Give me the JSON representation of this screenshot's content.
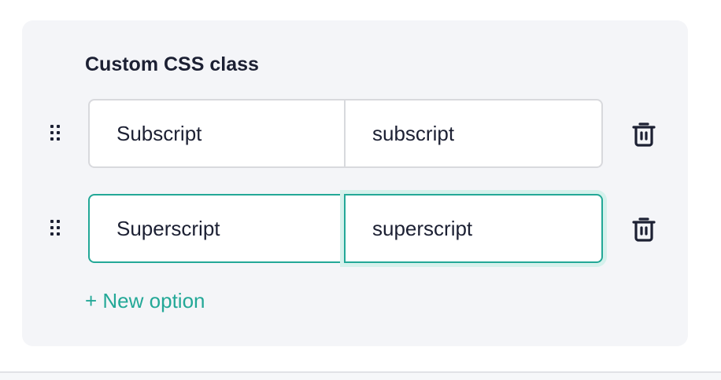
{
  "section": {
    "title": "Custom CSS class"
  },
  "options": [
    {
      "label": "Subscript",
      "value": "subscript",
      "state": "default"
    },
    {
      "label": "Superscript",
      "value": "superscript",
      "state": "focused"
    }
  ],
  "actions": {
    "new_option_label": "+ New option"
  },
  "icons": {
    "drag": "drag-handle-icon",
    "delete": "trash-icon"
  },
  "colors": {
    "accent": "#23a897",
    "text": "#1c2033",
    "panel_bg": "#f4f5f8",
    "focus_ring": "#d5f1ec"
  }
}
